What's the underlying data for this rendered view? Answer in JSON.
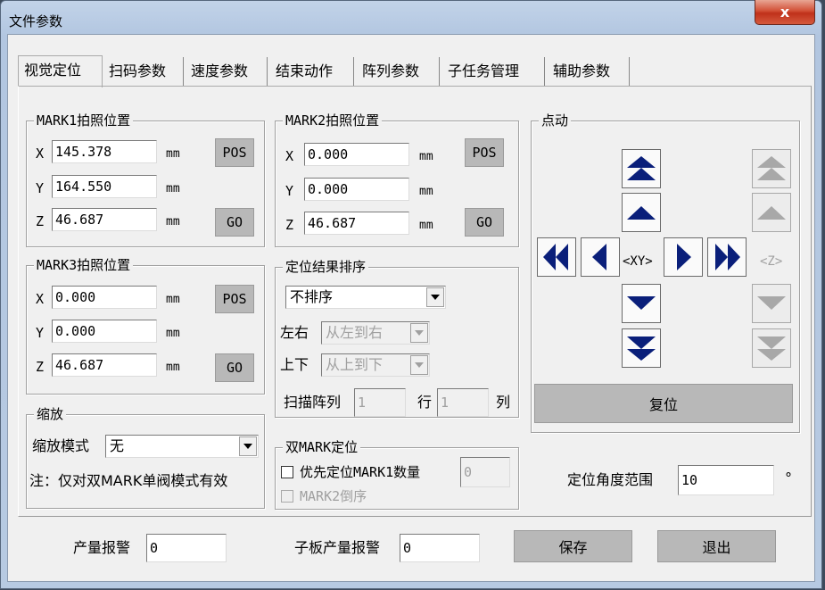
{
  "window": {
    "title": "文件参数",
    "close_glyph": "x"
  },
  "tabs": [
    {
      "label": "视觉定位",
      "active": true
    },
    {
      "label": "扫码参数"
    },
    {
      "label": "速度参数"
    },
    {
      "label": "结束动作"
    },
    {
      "label": "阵列参数"
    },
    {
      "label": "子任务管理"
    },
    {
      "label": "辅助参数"
    }
  ],
  "mark1": {
    "title": "MARK1拍照位置",
    "x_label": "X",
    "y_label": "Y",
    "z_label": "Z",
    "x": "145.378",
    "y": "164.550",
    "z": "46.687",
    "unit": "mm",
    "pos_button": "POS",
    "go_button": "GO"
  },
  "mark2": {
    "title": "MARK2拍照位置",
    "x_label": "X",
    "y_label": "Y",
    "z_label": "Z",
    "x": "0.000",
    "y": "0.000",
    "z": "46.687",
    "unit": "mm",
    "pos_button": "POS",
    "go_button": "GO"
  },
  "mark3": {
    "title": "MARK3拍照位置",
    "x_label": "X",
    "y_label": "Y",
    "z_label": "Z",
    "x": "0.000",
    "y": "0.000",
    "z": "46.687",
    "unit": "mm",
    "pos_button": "POS",
    "go_button": "GO"
  },
  "sort": {
    "title": "定位结果排序",
    "mode_value": "不排序",
    "lr_label": "左右",
    "lr_value": "从左到右",
    "ud_label": "上下",
    "ud_value": "从上到下",
    "scan_array_label": "扫描阵列",
    "rows_value": "1",
    "rows_unit": "行",
    "cols_value": "1",
    "cols_unit": "列"
  },
  "zoom": {
    "title": "缩放",
    "mode_label": "缩放模式",
    "mode_value": "无",
    "note": "注：仅对双MARK单阀模式有效"
  },
  "dual_mark": {
    "title": "双MARK定位",
    "priority_label": "优先定位MARK1数量",
    "priority_value": "0",
    "reverse_label": "MARK2倒序"
  },
  "jog": {
    "title": "点动",
    "xy_label": "<XY>",
    "z_label": "<Z>",
    "reset_button": "复位"
  },
  "angle": {
    "label": "定位角度范围",
    "value": "10",
    "unit": "°"
  },
  "footer": {
    "output_alarm_label": "产量报警",
    "output_alarm_value": "0",
    "sub_output_alarm_label": "子板产量报警",
    "sub_output_alarm_value": "0",
    "save_button": "保存",
    "exit_button": "退出"
  },
  "colors": {
    "jog_arrow": "#0a1f7a",
    "disabled_arrow": "#a8a8a8",
    "button_gray": "#b8b8b8",
    "close_red": "#c0311a"
  }
}
